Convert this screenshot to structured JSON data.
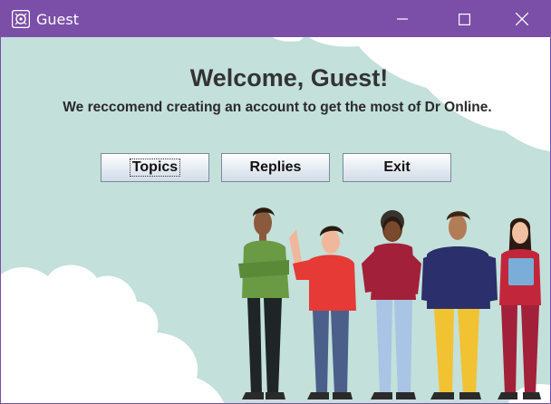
{
  "window": {
    "title": "Guest",
    "controls": [
      "minimize-icon",
      "maximize-icon",
      "close-icon"
    ],
    "titlebar_color": "#7b4fa8"
  },
  "main": {
    "headline": "Welcome, Guest!",
    "subline": "We reccomend creating an account to get the most of Dr Online."
  },
  "buttons": {
    "topics": "Topics",
    "replies": "Replies",
    "exit": "Exit"
  },
  "colors": {
    "background": "#c3e0da",
    "cloud": "#ffffff"
  }
}
